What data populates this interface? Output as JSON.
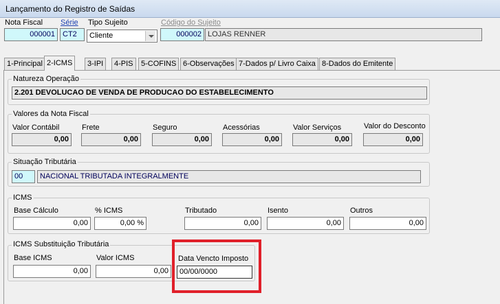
{
  "window": {
    "title": "Lançamento do Registro de Saídas"
  },
  "header": {
    "nota_fiscal_label": "Nota Fiscal",
    "nota_fiscal_value": "000001",
    "serie_label": "Série",
    "serie_value": "CT2",
    "tipo_sujeito_label": "Tipo Sujeito",
    "tipo_sujeito_value": "Cliente",
    "codigo_sujeito_label": "Código do Sujeito",
    "codigo_sujeito_value": "000002",
    "sujeito_nome": "LOJAS RENNER"
  },
  "tabs": [
    {
      "label": "1-Principal",
      "active": false
    },
    {
      "label": "2-ICMS",
      "active": true
    },
    {
      "label": "3-IPI",
      "active": false
    },
    {
      "label": "4-PIS",
      "active": false
    },
    {
      "label": "5-COFINS",
      "active": false
    },
    {
      "label": "6-Observações",
      "active": false
    },
    {
      "label": "7-Dados p/ Livro Caixa",
      "active": false
    },
    {
      "label": "8-Dados do Emitente",
      "active": false
    }
  ],
  "natureza": {
    "title": "Natureza Operação",
    "value": "2.201 DEVOLUCAO DE VENDA DE PRODUCAO DO  ESTABELECIMENTO"
  },
  "valores": {
    "title": "Valores da Nota Fiscal",
    "fields": [
      {
        "label": "Valor Contábil",
        "value": "0,00"
      },
      {
        "label": "Frete",
        "value": "0,00"
      },
      {
        "label": "Seguro",
        "value": "0,00"
      },
      {
        "label": "Acessórias",
        "value": "0,00"
      },
      {
        "label": "Valor Serviços",
        "value": "0,00"
      },
      {
        "label": "Valor do Desconto",
        "value": "0,00"
      }
    ]
  },
  "situacao": {
    "title": "Situação Tributária",
    "code": "00",
    "description": "NACIONAL TRIBUTADA INTEGRALMENTE"
  },
  "icms": {
    "title": "ICMS",
    "fields": [
      {
        "label": "Base Cálculo",
        "value": "0,00"
      },
      {
        "label": "% ICMS",
        "value": "0,00 %"
      },
      {
        "label": "Tributado",
        "value": "0,00"
      },
      {
        "label": "Isento",
        "value": "0,00"
      },
      {
        "label": "Outros",
        "value": "0,00"
      }
    ]
  },
  "st": {
    "title": "ICMS Substituição Tributária",
    "base_label": "Base ICMS",
    "base_value": "0,00",
    "valor_label": "Valor ICMS",
    "valor_value": "0,00",
    "data_label": "Data Vencto Imposto",
    "data_value": "00/00/0000"
  },
  "colors": {
    "highlight": "#e0202a",
    "field_cyan": "#d0f8fb"
  }
}
